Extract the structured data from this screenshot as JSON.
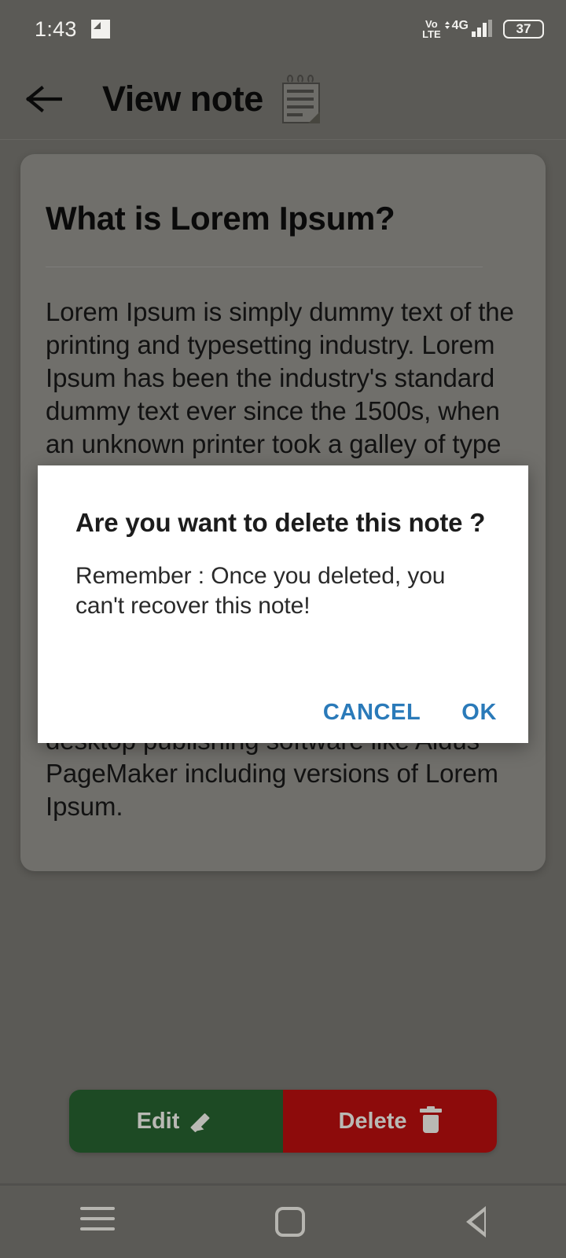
{
  "status_bar": {
    "time": "1:43",
    "screenshot_icon": "screenshot-icon",
    "volte_top": "Vo",
    "volte_bottom": "LTE",
    "network": "4G",
    "battery_level": "37"
  },
  "app_bar": {
    "back_icon": "back-arrow-icon",
    "title": "View note",
    "note_icon": "notepad-icon"
  },
  "note": {
    "title": "What is Lorem Ipsum?",
    "body": "Lorem Ipsum is simply dummy text of the printing and typesetting industry. Lorem Ipsum has been the industry's standard dummy text ever since the 1500s, when an unknown printer took a galley of type and scrambled it to make a type specimen book. It has survived not only five centuries, but also the leap into electronic typesetting, remaining essentially unchanged. It was popularised in the 1960s with the release of Letraset sheets containing Lorem Ipsum passages, and more recently with desktop publishing software like Aldus PageMaker including versions of Lorem Ipsum."
  },
  "actions": {
    "edit_label": "Edit",
    "edit_icon": "pencil-icon",
    "edit_color": "#1d4a24",
    "delete_label": "Delete",
    "delete_icon": "trash-icon",
    "delete_color": "#8d0b0b"
  },
  "dialog": {
    "title": "Are you want to delete this note ?",
    "message": "Remember : Once you deleted, you can't recover this note!",
    "cancel_label": "CANCEL",
    "ok_label": "OK",
    "accent_color": "#2a7ab9"
  },
  "nav_bar": {
    "recents_icon": "recents-icon",
    "home_icon": "home-icon",
    "back_icon": "nav-back-icon"
  }
}
